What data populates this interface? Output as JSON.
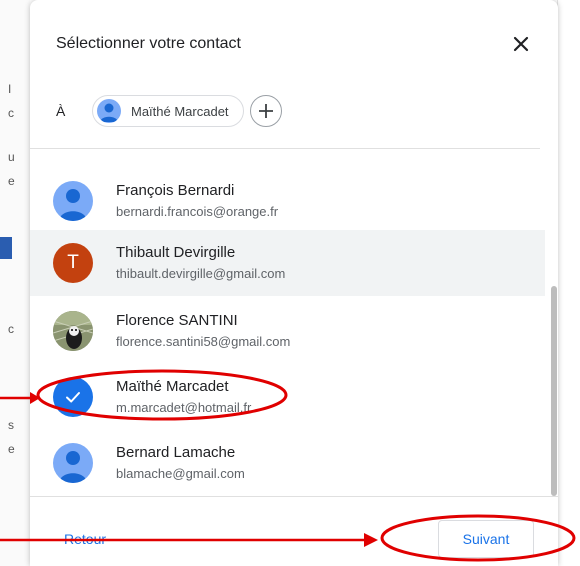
{
  "dialog": {
    "title": "Sélectionner votre contact",
    "to_label": "À",
    "selected_chip": "Maïthé Marcadet"
  },
  "contacts": [
    {
      "name": "François Bernardi",
      "email": "bernardi.francois@orange.fr",
      "avatar": "person-icon"
    },
    {
      "name": "Thibault Devirgille",
      "email": "thibault.devirgille@gmail.com",
      "avatar": "letter",
      "letter": "T",
      "avatar_color": "#c3410f",
      "highlighted": true
    },
    {
      "name": "Florence SANTINI",
      "email": "florence.santini58@gmail.com",
      "avatar": "photo"
    },
    {
      "name": "Maïthé Marcadet",
      "email": "m.marcadet@hotmail.fr",
      "avatar": "check-icon",
      "selected": true
    },
    {
      "name": "Bernard Lamache",
      "email": "blamache@gmail.com",
      "avatar": "person-icon"
    }
  ],
  "footer": {
    "back_label": "Retour",
    "next_label": "Suivant"
  },
  "colors": {
    "accent": "#1a73e8",
    "annotation": "#e00000"
  }
}
